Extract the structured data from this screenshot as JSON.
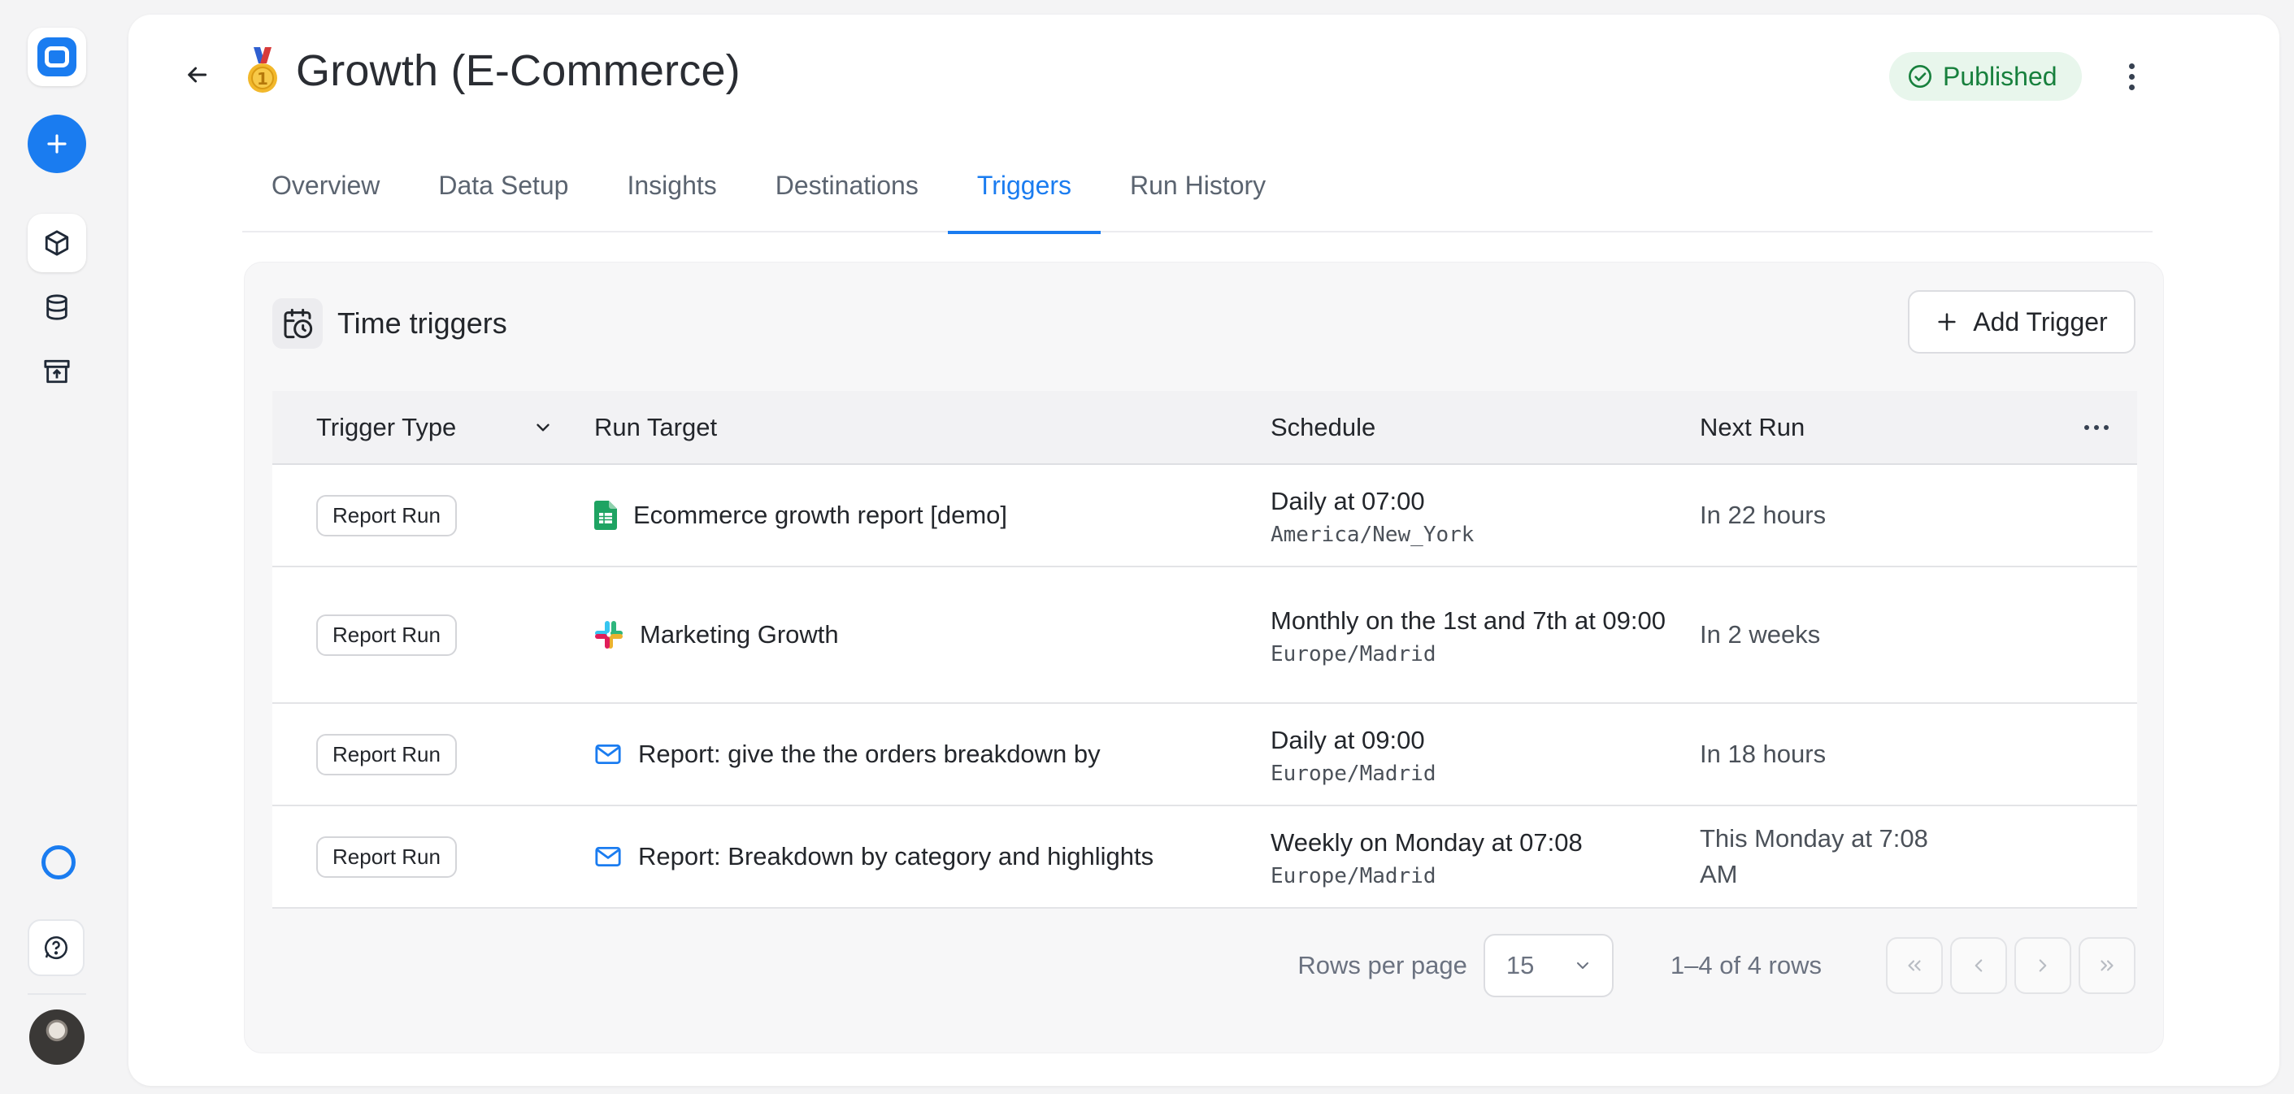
{
  "rail": {
    "icons": [
      "app-logo-icon",
      "plus-icon",
      "cube-icon",
      "database-icon",
      "archive-icon",
      "status-ring-icon",
      "help-chat-icon"
    ]
  },
  "header": {
    "title": "Growth (E-Commerce)",
    "status": "Published"
  },
  "tabs": [
    {
      "label": "Overview"
    },
    {
      "label": "Data Setup"
    },
    {
      "label": "Insights"
    },
    {
      "label": "Destinations"
    },
    {
      "label": "Triggers",
      "active": true
    },
    {
      "label": "Run History"
    }
  ],
  "card": {
    "title": "Time triggers",
    "add_label": "Add Trigger"
  },
  "table": {
    "columns": [
      "Trigger Type",
      "Run Target",
      "Schedule",
      "Next Run"
    ],
    "rows": [
      {
        "type": "Report Run",
        "target": "Ecommerce growth report [demo]",
        "target_icon": "google-sheets-icon",
        "schedule": "Daily at 07:00",
        "timezone": "America/New_York",
        "next": "In 22 hours"
      },
      {
        "type": "Report Run",
        "target": "Marketing Growth",
        "target_icon": "slack-icon",
        "schedule": "Monthly on the 1st and 7th at 09:00",
        "timezone": "Europe/Madrid",
        "next": "In 2 weeks"
      },
      {
        "type": "Report Run",
        "target": "Report: give the the orders breakdown by",
        "target_icon": "mail-icon",
        "schedule": "Daily at 09:00",
        "timezone": "Europe/Madrid",
        "next": "In 18 hours"
      },
      {
        "type": "Report Run",
        "target": "Report: Breakdown by category and highlights",
        "target_icon": "mail-icon",
        "schedule": "Weekly on Monday at 07:08",
        "timezone": "Europe/Madrid",
        "next": "This Monday at 7:08 AM"
      }
    ]
  },
  "pagination": {
    "rows_per_page_label": "Rows per page",
    "rows_per_page": "15",
    "range": "1–4 of 4 rows"
  },
  "colors": {
    "accent": "#1a7cf0",
    "published_bg": "#e8f6ec",
    "published_text": "#17803d"
  }
}
